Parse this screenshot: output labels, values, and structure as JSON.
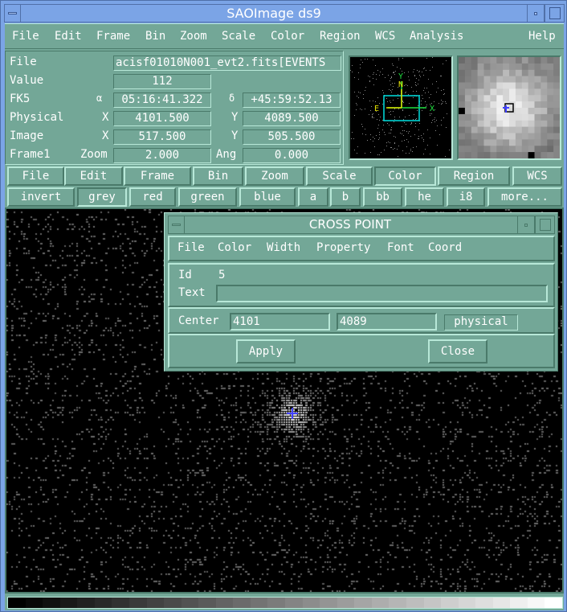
{
  "window": {
    "title": "SAOImage ds9"
  },
  "menubar": [
    "File",
    "Edit",
    "Frame",
    "Bin",
    "Zoom",
    "Scale",
    "Color",
    "Region",
    "WCS",
    "Analysis",
    "Help"
  ],
  "info": {
    "file_label": "File",
    "file_value": "acisf01010N001_evt2.fits[EVENTS",
    "value_label": "Value",
    "value": "112",
    "fk5_label": "FK5",
    "alpha_symbol": "α",
    "alpha_value": "05:16:41.322",
    "delta_symbol": "δ",
    "delta_value": "+45:59:52.13",
    "physical_label": "Physical",
    "physical_x_label": "X",
    "physical_x": "4101.500",
    "physical_y_label": "Y",
    "physical_y": "4089.500",
    "image_label": "Image",
    "image_x_label": "X",
    "image_x": "517.500",
    "image_y_label": "Y",
    "image_y": "505.500",
    "frame_label": "Frame1",
    "zoom_label": "Zoom",
    "zoom_value": "2.000",
    "angle_label": "Ang",
    "angle_value": "0.000"
  },
  "panner": {
    "compass_n": "N",
    "compass_e": "E",
    "axis_x": "X",
    "axis_y": "Y"
  },
  "buttonbar_main": [
    {
      "label": "File",
      "active": false
    },
    {
      "label": "Edit",
      "active": false
    },
    {
      "label": "Frame",
      "active": false
    },
    {
      "label": "Bin",
      "active": false
    },
    {
      "label": "Zoom",
      "active": false
    },
    {
      "label": "Scale",
      "active": false
    },
    {
      "label": "Color",
      "active": true
    },
    {
      "label": "Region",
      "active": false
    },
    {
      "label": "WCS",
      "active": false
    }
  ],
  "buttonbar_color": [
    {
      "label": "invert",
      "active": false
    },
    {
      "label": "grey",
      "active": true
    },
    {
      "label": "red",
      "active": false
    },
    {
      "label": "green",
      "active": false
    },
    {
      "label": "blue",
      "active": false
    },
    {
      "label": "a",
      "active": false
    },
    {
      "label": "b",
      "active": false
    },
    {
      "label": "bb",
      "active": false
    },
    {
      "label": "he",
      "active": false
    },
    {
      "label": "i8",
      "active": false
    },
    {
      "label": "more...",
      "active": false
    }
  ],
  "dialog": {
    "title": "CROSS POINT",
    "menu": [
      "File",
      "Color",
      "Width",
      "Property",
      "Font",
      "Coord"
    ],
    "id_label": "Id",
    "id_value": "5",
    "text_label": "Text",
    "text_value": "",
    "center_label": "Center",
    "center_x": "4101",
    "center_y": "4089",
    "coord_system": "physical",
    "apply_label": "Apply",
    "close_label": "Close"
  },
  "colors": {
    "ui_bg": "#73a797",
    "title_bg": "#7ba4e6",
    "region_marker": "#4040ff"
  }
}
